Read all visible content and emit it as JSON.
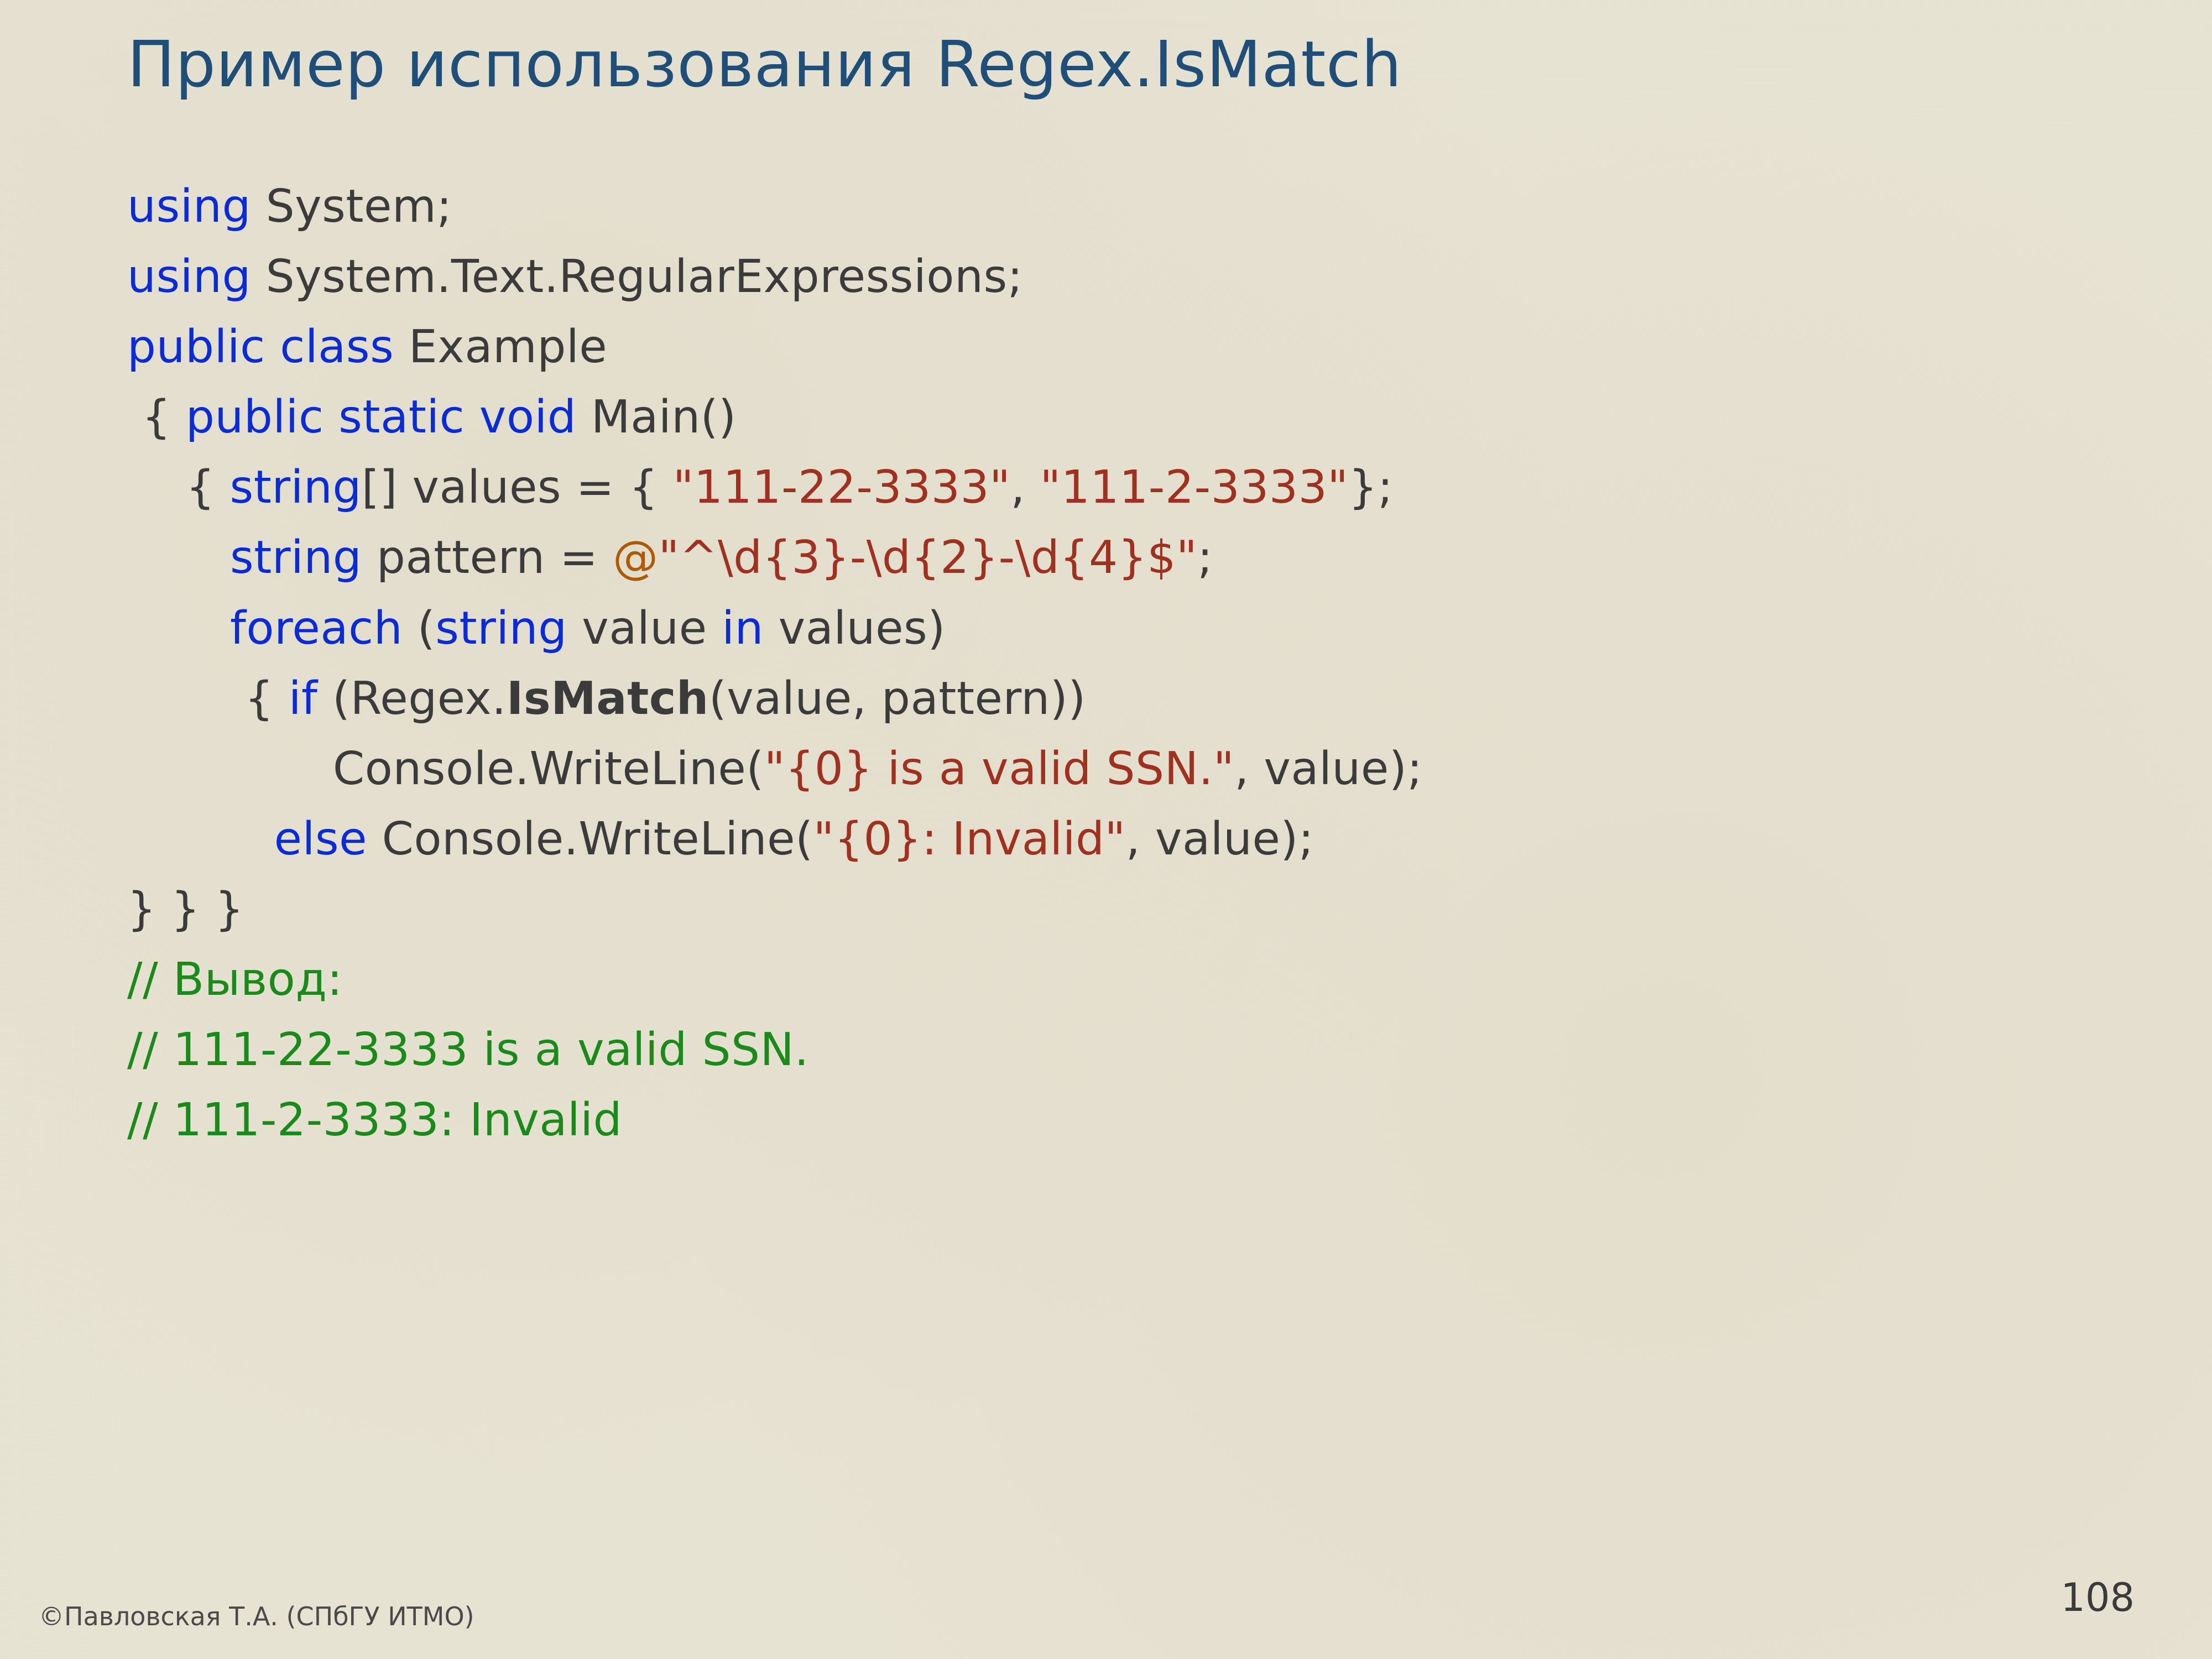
{
  "title": "Пример использования Regex.IsMatch",
  "code": {
    "l1_kw": "using",
    "l1_r": " System;",
    "l2_kw": "using",
    "l2_r": " System.Text.RegularExpressions;",
    "l3_kw": "public class",
    "l3_r": " Example",
    "l4_a": " { ",
    "l4_kw": "public static void",
    "l4_r": " Main()",
    "l5_a": "    { ",
    "l5_kw": "string",
    "l5_b": "[] values = { ",
    "l5_s1": "\"111-22-3333\"",
    "l5_c": ", ",
    "l5_s2": "\"111-2-3333\"",
    "l5_d": "};",
    "l6_a": "       ",
    "l6_kw": "string",
    "l6_b": " pattern = ",
    "l6_at": "@",
    "l6_q1": "\"^",
    "l6_p1": "\\d",
    "l6_p2": "{3}",
    "l6_p3": "-",
    "l6_p4": "\\d",
    "l6_p5": "{2}",
    "l6_p6": "-",
    "l6_p7": "\\d",
    "l6_p8": "{4}",
    "l6_p9": "$",
    "l6_q2": "\"",
    "l6_end": ";",
    "l7_a": "       ",
    "l7_kw1": "foreach",
    "l7_b": " (",
    "l7_kw2": "string",
    "l7_c": " value ",
    "l7_kw3": "in",
    "l7_d": " values)",
    "l8_a": "        { ",
    "l8_kw": "if",
    "l8_b": " (Regex.",
    "l8_bold": "IsMatch",
    "l8_c": "(value, pattern))",
    "l9_a": "              Console.WriteLine(",
    "l9_s": "\"{0} is a valid SSN.\"",
    "l9_b": ", value);",
    "l10_a": "          ",
    "l10_kw": "else",
    "l10_b": " Console.WriteLine(",
    "l10_s": "\"{0}: Invalid\"",
    "l10_c": ", value);",
    "l11": "} } }",
    "l12": "// Вывод:",
    "l13": "// 111-22-3333 is a valid SSN.",
    "l14": "// 111-2-3333: Invalid"
  },
  "footer": {
    "copyright": "©Павловская Т.А. (СПбГУ ИТМО)",
    "page": "108"
  }
}
